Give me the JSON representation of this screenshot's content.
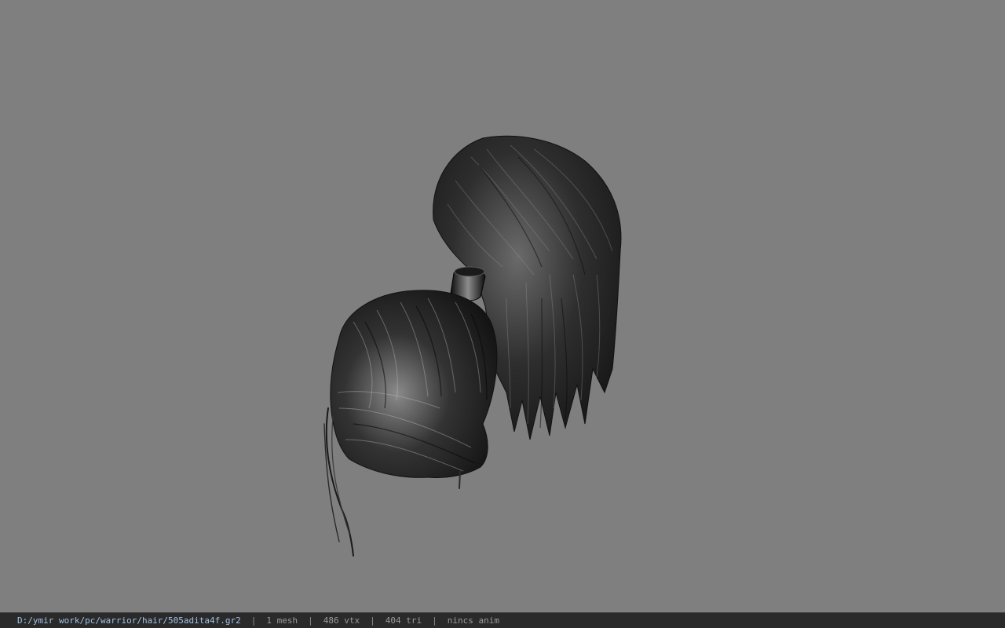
{
  "statusbar": {
    "file_path": "D:/ymir work/pc/warrior/hair/505adita4f.gr2",
    "separator": "|",
    "mesh_count": "1 mesh",
    "vertex_count": "486 vtx",
    "triangle_count": "404 tri",
    "animation": "nincs anim"
  },
  "colors": {
    "viewport_bg": "#7f7f7f",
    "statusbar_bg": "#2a2a2a",
    "path_text": "#9fc3e6",
    "status_text": "#9a9a9a"
  }
}
